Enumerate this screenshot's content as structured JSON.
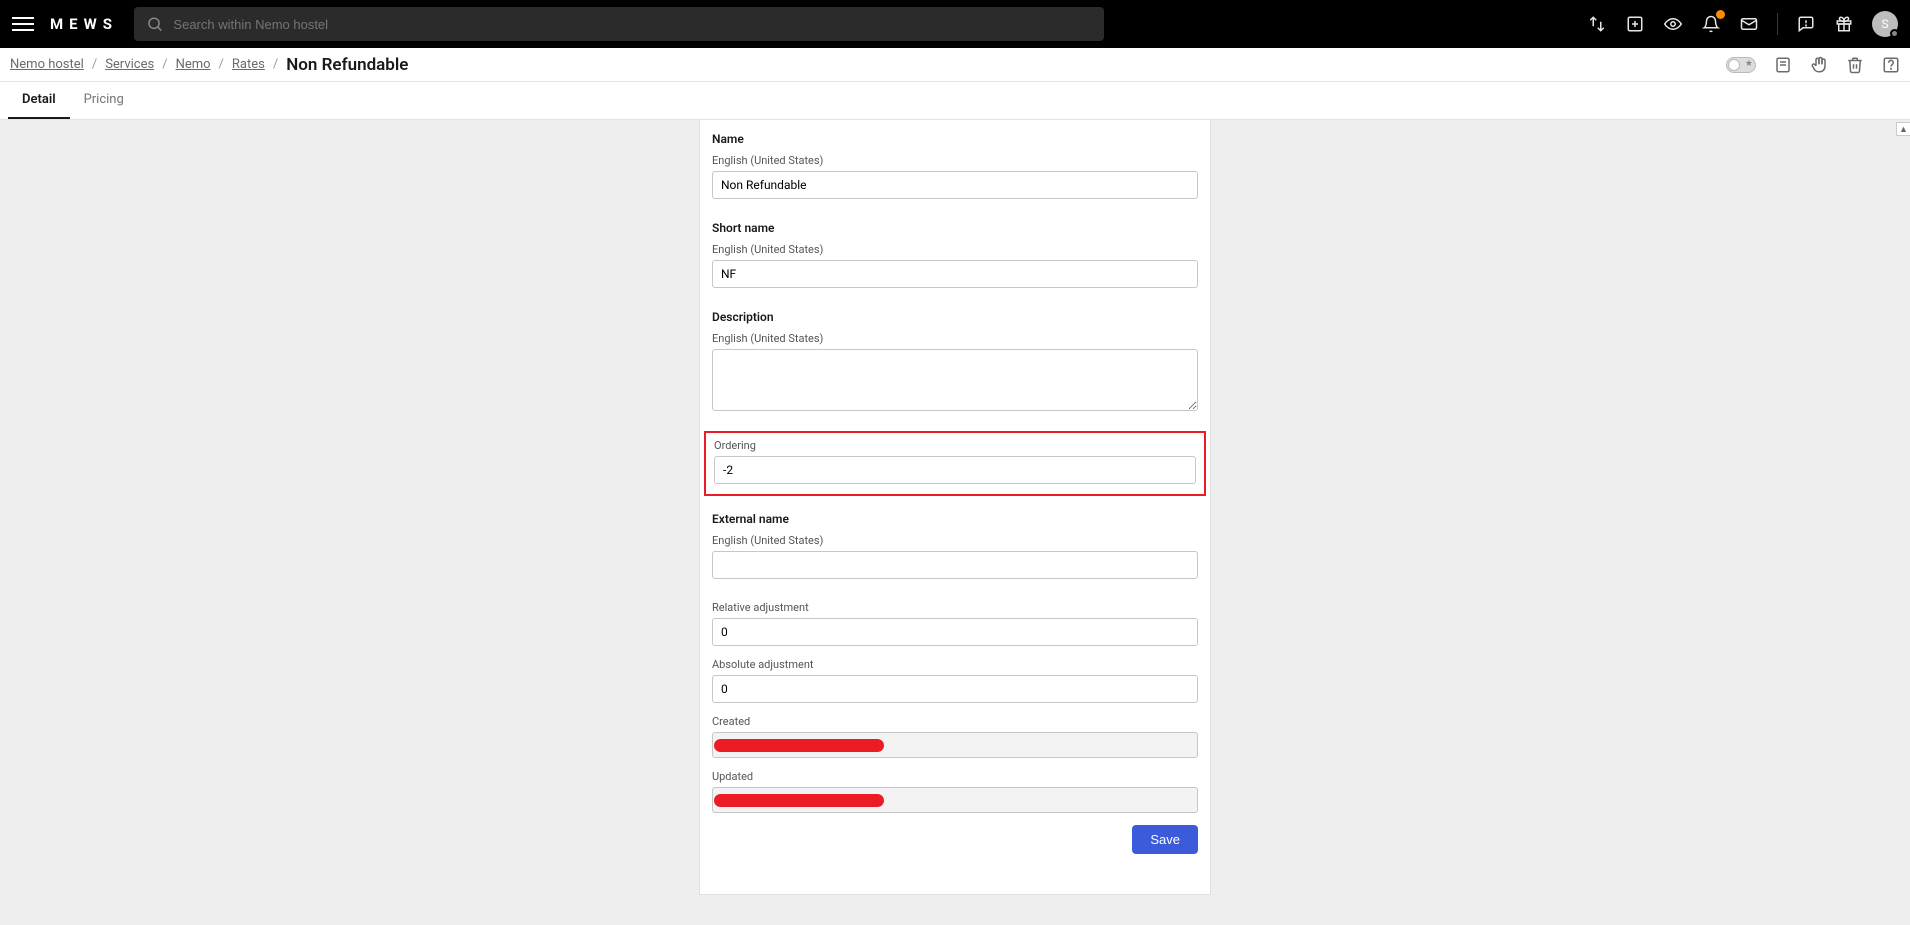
{
  "logo": "MEWS",
  "search": {
    "placeholder": "Search within Nemo hostel"
  },
  "avatar_initial": "S",
  "breadcrumbs": {
    "items": [
      "Nemo hostel",
      "Services",
      "Nemo",
      "Rates"
    ],
    "current": "Non Refundable"
  },
  "tabs": {
    "detail": "Detail",
    "pricing": "Pricing"
  },
  "form": {
    "name": {
      "label": "Name",
      "sublabel": "English (United States)",
      "value": "Non Refundable"
    },
    "shortname": {
      "label": "Short name",
      "sublabel": "English (United States)",
      "value": "NF"
    },
    "description": {
      "label": "Description",
      "sublabel": "English (United States)",
      "value": ""
    },
    "ordering": {
      "label": "Ordering",
      "value": "-2"
    },
    "externalname": {
      "label": "External name",
      "sublabel": "English (United States)",
      "value": ""
    },
    "relative": {
      "label": "Relative adjustment",
      "value": "0"
    },
    "absolute": {
      "label": "Absolute adjustment",
      "value": "0"
    },
    "created": {
      "label": "Created"
    },
    "updated": {
      "label": "Updated"
    },
    "save": "Save"
  }
}
